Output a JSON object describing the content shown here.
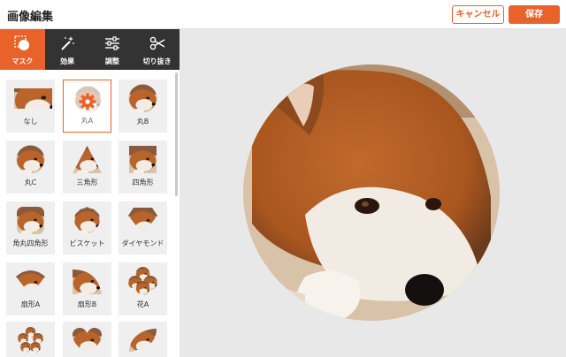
{
  "header": {
    "title": "画像編集",
    "cancel_label": "キャンセル",
    "save_label": "保存"
  },
  "colors": {
    "accent": "#e8622a",
    "toolbar_bg": "#333333",
    "canvas_bg": "#e8e8e8"
  },
  "toolbar": {
    "tools": [
      {
        "label": "マスク",
        "icon": "mask-icon",
        "active": true
      },
      {
        "label": "効果",
        "icon": "magic-wand-icon",
        "active": false
      },
      {
        "label": "調整",
        "icon": "sliders-icon",
        "active": false
      },
      {
        "label": "切り抜き",
        "icon": "scissors-icon",
        "active": false
      }
    ]
  },
  "masks": [
    {
      "label": "なし",
      "selected": false
    },
    {
      "label": "丸A",
      "selected": true
    },
    {
      "label": "丸B",
      "selected": false
    },
    {
      "label": "丸C",
      "selected": false
    },
    {
      "label": "三角形",
      "selected": false
    },
    {
      "label": "四角形",
      "selected": false
    },
    {
      "label": "角丸四角形",
      "selected": false
    },
    {
      "label": "ビスケット",
      "selected": false
    },
    {
      "label": "ダイヤモンド",
      "selected": false
    },
    {
      "label": "扇形A",
      "selected": false
    },
    {
      "label": "扇形B",
      "selected": false
    },
    {
      "label": "花A",
      "selected": false
    }
  ]
}
